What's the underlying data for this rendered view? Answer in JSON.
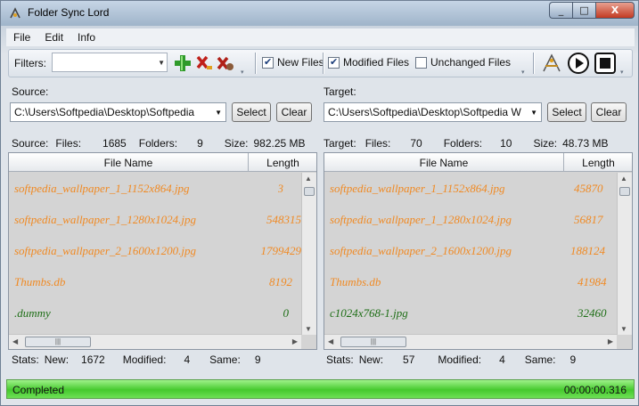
{
  "window": {
    "title": "Folder Sync Lord",
    "controls": [
      "_",
      "□",
      "X"
    ]
  },
  "menu": [
    "File",
    "Edit",
    "Info"
  ],
  "toolbar": {
    "filters_label": "Filters:",
    "filter_value": "",
    "checks": [
      {
        "label": "New Files",
        "checked": true
      },
      {
        "label": "Modified Files",
        "checked": true
      },
      {
        "label": "Unchanged Files",
        "checked": false
      }
    ]
  },
  "source": {
    "label": "Source:",
    "path": "C:\\Users\\Softpedia\\Desktop\\Softpedia",
    "select_label": "Select",
    "clear_label": "Clear",
    "summary": {
      "prefix": "Source:",
      "files_label": "Files:",
      "files": "1685",
      "folders_label": "Folders:",
      "folders": "9",
      "size_label": "Size:",
      "size": "982.25 MB"
    },
    "columns": [
      "File Name",
      "Length"
    ],
    "rows": [
      {
        "name": "softpedia_wallpaper_1_1152x864.jpg",
        "length": "3",
        "status": "orange"
      },
      {
        "name": "softpedia_wallpaper_1_1280x1024.jpg",
        "length": "548315",
        "status": "orange"
      },
      {
        "name": "softpedia_wallpaper_2_1600x1200.jpg",
        "length": "1799429",
        "status": "orange"
      },
      {
        "name": "Thumbs.db",
        "length": "8192",
        "status": "orange"
      },
      {
        "name": ".dummy",
        "length": "0",
        "status": "green"
      }
    ],
    "stats": {
      "prefix": "Stats:",
      "new_label": "New:",
      "new": "1672",
      "modified_label": "Modified:",
      "modified": "4",
      "same_label": "Same:",
      "same": "9"
    }
  },
  "target": {
    "label": "Target:",
    "path": "C:\\Users\\Softpedia\\Desktop\\Softpedia W",
    "select_label": "Select",
    "clear_label": "Clear",
    "summary": {
      "prefix": "Target:",
      "files_label": "Files:",
      "files": "70",
      "folders_label": "Folders:",
      "folders": "10",
      "size_label": "Size:",
      "size": "48.73 MB"
    },
    "columns": [
      "File Name",
      "Length"
    ],
    "rows": [
      {
        "name": "softpedia_wallpaper_1_1152x864.jpg",
        "length": "45870",
        "status": "orange"
      },
      {
        "name": "softpedia_wallpaper_1_1280x1024.jpg",
        "length": "56817",
        "status": "orange"
      },
      {
        "name": "softpedia_wallpaper_2_1600x1200.jpg",
        "length": "188124",
        "status": "orange"
      },
      {
        "name": "Thumbs.db",
        "length": "41984",
        "status": "orange"
      },
      {
        "name": "c1024x768-1.jpg",
        "length": "32460",
        "status": "green"
      }
    ],
    "stats": {
      "prefix": "Stats:",
      "new_label": "New:",
      "new": "57",
      "modified_label": "Modified:",
      "modified": "4",
      "same_label": "Same:",
      "same": "9"
    }
  },
  "status": {
    "text": "Completed",
    "time": "00:00:00.316"
  },
  "colors": {
    "modified_row": "#f08a24",
    "new_row": "#1e6e16",
    "status_bar": "#45c92d"
  }
}
